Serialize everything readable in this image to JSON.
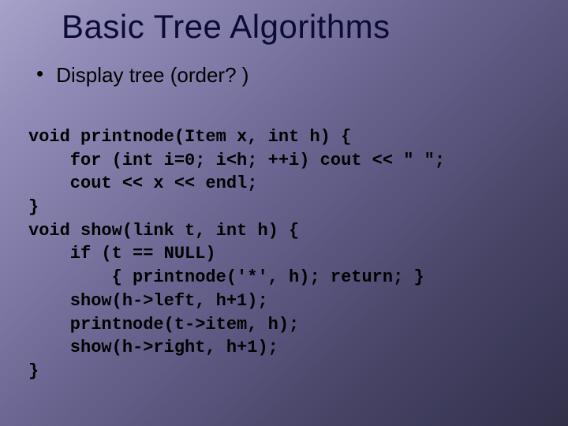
{
  "title": "Basic Tree Algorithms",
  "bullet": {
    "marker": "•",
    "text": "Display tree (order? )"
  },
  "code": {
    "l1": "void printnode(Item x, int h) {",
    "l2": "    for (int i=0; i<h; ++i) cout << \" \";",
    "l3": "    cout << x << endl;",
    "l4": "}",
    "l5": "void show(link t, int h) {",
    "l6": "    if (t == NULL)",
    "l7": "        { printnode('*', h); return; }",
    "l8": "    show(h->left, h+1);",
    "l9": "    printnode(t->item, h);",
    "l10": "    show(h->right, h+1);",
    "l11": "}"
  }
}
